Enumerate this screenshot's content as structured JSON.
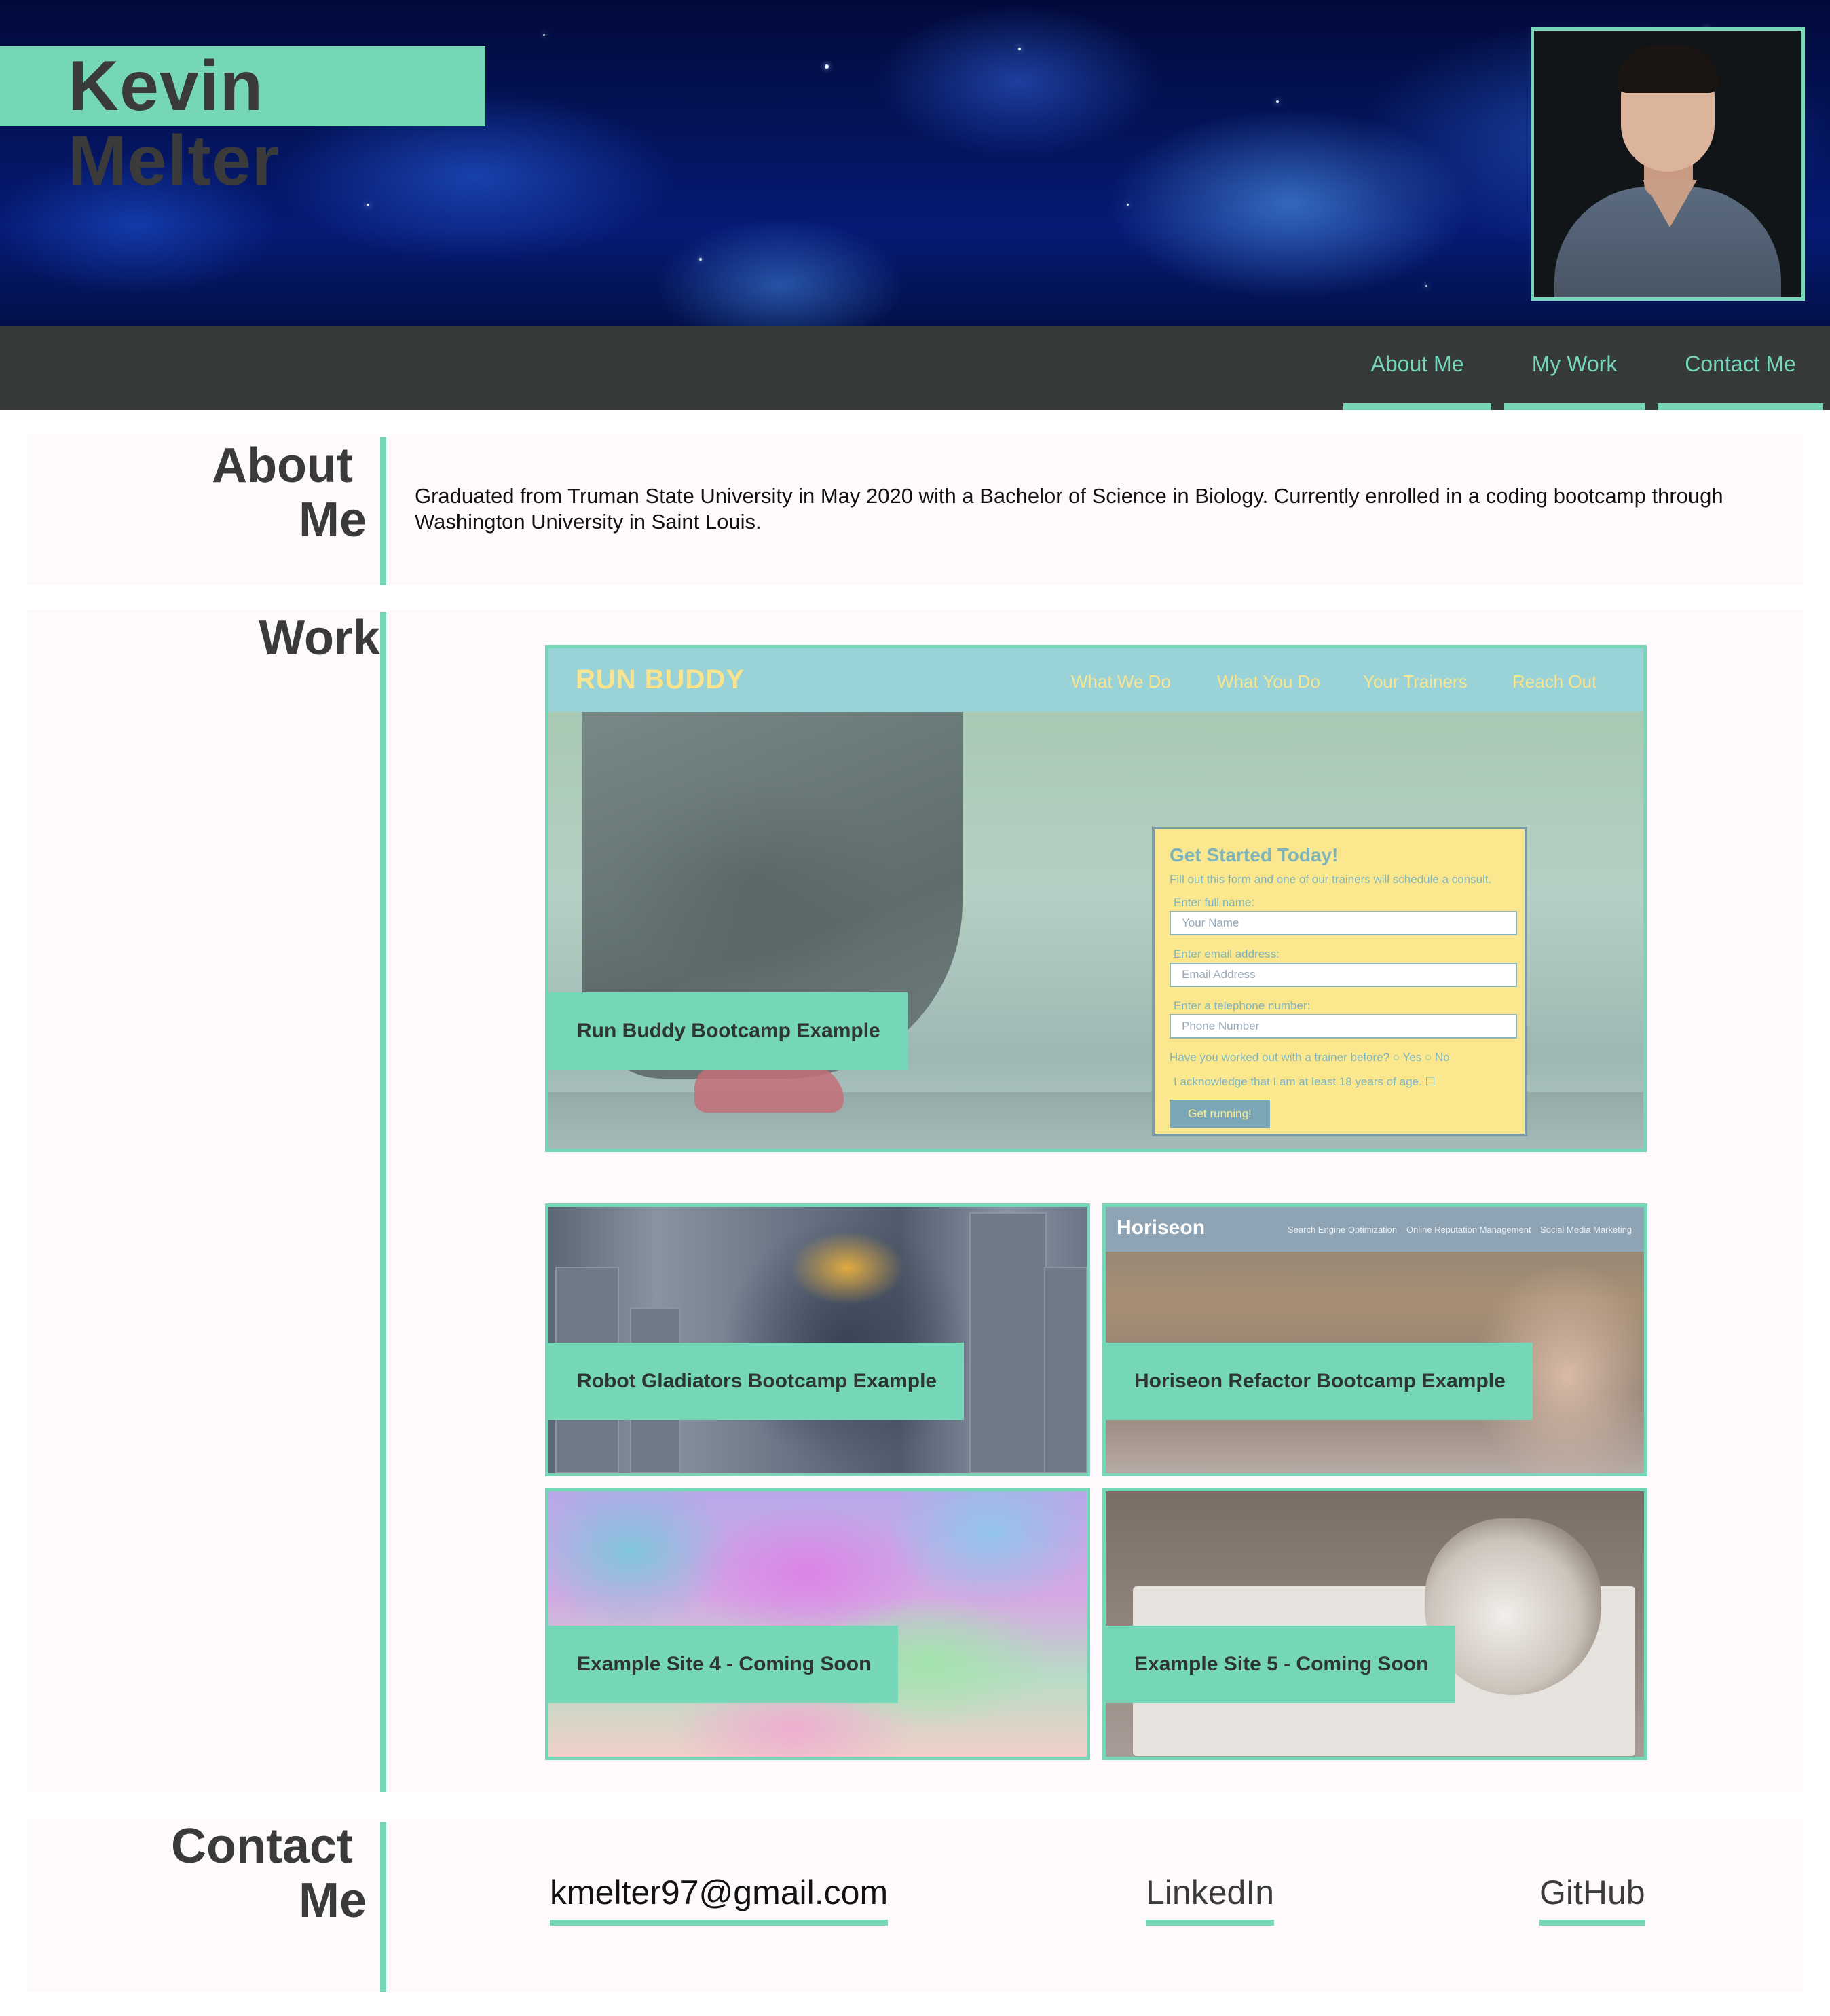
{
  "header": {
    "name": "Kevin Melter",
    "profile_photo": "portrait-photo"
  },
  "nav": {
    "items": [
      {
        "label": "About Me"
      },
      {
        "label": "My Work"
      },
      {
        "label": "Contact Me"
      }
    ]
  },
  "about": {
    "title": "About Me",
    "title_line1": "About",
    "title_line2": "Me",
    "text": "Graduated from Truman State University in May 2020 with a Bachelor of Science in Biology. Currently enrolled in a coding bootcamp through Washington University in Saint Louis."
  },
  "work": {
    "title": "Work",
    "projects": [
      {
        "label": "Run Buddy Bootcamp Example"
      },
      {
        "label": "Robot Gladiators Bootcamp Example"
      },
      {
        "label": "Horiseon Refactor Bootcamp Example"
      },
      {
        "label": "Example Site 4 - Coming Soon"
      },
      {
        "label": "Example Site 5 - Coming Soon"
      }
    ],
    "run_buddy_preview": {
      "logo": "RUN BUDDY",
      "nav": [
        "What We Do",
        "What You Do",
        "Your Trainers",
        "Reach Out"
      ],
      "form_title": "Get Started Today!",
      "form_subtitle": "Fill out this form and one of our trainers will schedule a consult.",
      "name_label": "Enter full name:",
      "name_placeholder": "Your Name",
      "email_label": "Enter email address:",
      "email_placeholder": "Email Address",
      "phone_label": "Enter a telephone number:",
      "phone_placeholder": "Phone Number",
      "trainer_question": "Have you worked out with a trainer before?",
      "yes": "Yes",
      "no": "No",
      "age_ack": "I acknowledge that I am at least 18 years of age.",
      "button": "Get running!"
    },
    "horiseon_preview": {
      "logo": "Horiseon",
      "nav": [
        "Search Engine Optimization",
        "Online Reputation Management",
        "Social Media Marketing"
      ]
    }
  },
  "contact": {
    "title_line1": "Contact",
    "title_line2": "Me",
    "email": "kmelter97@gmail.com",
    "linkedin": "LinkedIn",
    "github": "GitHub"
  },
  "colors": {
    "accent": "#75d6b8",
    "nav_bg": "#363a3b",
    "section_bg": "#fdf9fd",
    "text": "#3a3a3a"
  }
}
